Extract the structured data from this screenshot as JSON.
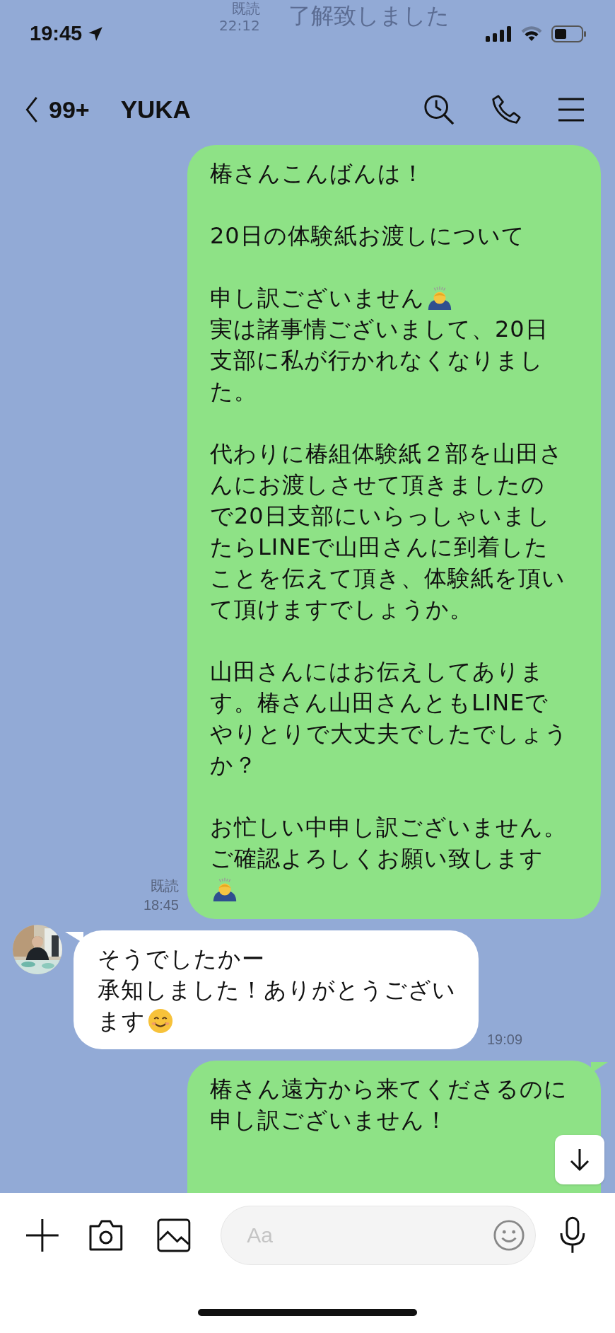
{
  "status_bar": {
    "time": "19:45"
  },
  "ghost_message": {
    "read": "既読",
    "time": "22:12",
    "text": "了解致しました"
  },
  "header": {
    "back_count": "99+",
    "title": "YUKA"
  },
  "messages": [
    {
      "kind": "outgoing",
      "tail": false,
      "read": "既読",
      "time": "18:45",
      "paragraphs": [
        [
          {
            "kind": "plain",
            "text": "椿さんこんばんは！"
          }
        ],
        [
          {
            "kind": "plain",
            "text": "20日の体験紙お渡しについて"
          }
        ],
        [
          {
            "kind": "bow",
            "text": "申し訳ございません"
          },
          {
            "kind": "plain",
            "text": "実は諸事情ございまして、20日"
          },
          {
            "kind": "plain",
            "text": "支部に私が行かれなくなりまし"
          },
          {
            "kind": "plain",
            "text": "た。"
          }
        ],
        [
          {
            "kind": "plain",
            "text": "代わりに椿組体験紙２部を山田さ"
          },
          {
            "kind": "plain",
            "text": "んにお渡しさせて頂きましたの"
          },
          {
            "kind": "plain",
            "text": "で20日支部にいらっしゃいまし"
          },
          {
            "kind": "plain",
            "text": "たらLINEで山田さんに到着した"
          },
          {
            "kind": "plain",
            "text": "ことを伝えて頂き、体験紙を頂い"
          },
          {
            "kind": "plain",
            "text": "て頂けますでしょうか。"
          }
        ],
        [
          {
            "kind": "plain",
            "text": "山田さんにはお伝えしてありま"
          },
          {
            "kind": "plain",
            "text": "す。椿さん山田さんともLINEで"
          },
          {
            "kind": "plain",
            "text": "やりとりで大丈夫でしたでしょう"
          },
          {
            "kind": "plain",
            "text": "か？"
          }
        ],
        [
          {
            "kind": "plain",
            "text": "お忙しい中申し訳ございません。"
          },
          {
            "kind": "plain",
            "text": "ご確認よろしくお願い致します"
          },
          {
            "kind": "bow"
          }
        ]
      ]
    },
    {
      "kind": "incoming",
      "tail": true,
      "time": "19:09",
      "paragraphs": [
        [
          {
            "kind": "plain",
            "text": "そうでしたかー"
          },
          {
            "kind": "plain",
            "text": "承知しました！ありがとうござい"
          },
          {
            "kind": "smile",
            "text": "ます"
          }
        ]
      ]
    },
    {
      "kind": "outgoing",
      "tail": true,
      "paragraphs": [
        [
          {
            "kind": "plain",
            "text": "椿さん遠方から来てくださるのに"
          },
          {
            "kind": "plain",
            "text": "申し訳ございません！"
          }
        ]
      ]
    }
  ],
  "composer": {
    "placeholder": "Aa"
  }
}
